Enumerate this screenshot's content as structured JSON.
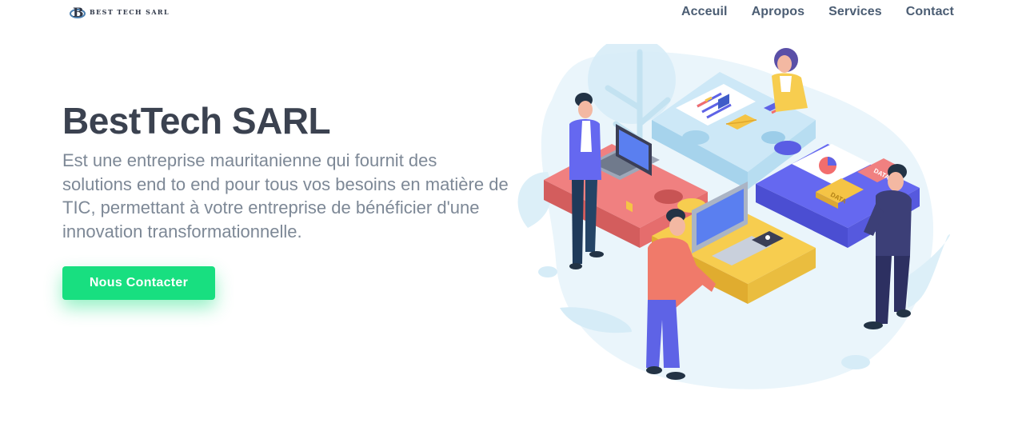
{
  "brand": {
    "logo_mark": "B",
    "name": "BEST TECH SARL"
  },
  "nav": {
    "items": [
      "Acceuil",
      "Apropos",
      "Services",
      "Contact"
    ]
  },
  "hero": {
    "title": "BestTech SARL",
    "description": "Est une entreprise mauritanienne qui fournit des solutions end to end pour tous vos besoins en matière de TIC, permettant à votre entreprise de bénéficier d'une innovation transformationnelle.",
    "cta_label": "Nous Contacter"
  },
  "illustration": {
    "label_data_1": "DATA",
    "label_data_2": "DATA"
  },
  "colors": {
    "accent": "#18df80",
    "title": "#3b4250",
    "text": "#7d8896",
    "nav": "#4b5d73"
  }
}
